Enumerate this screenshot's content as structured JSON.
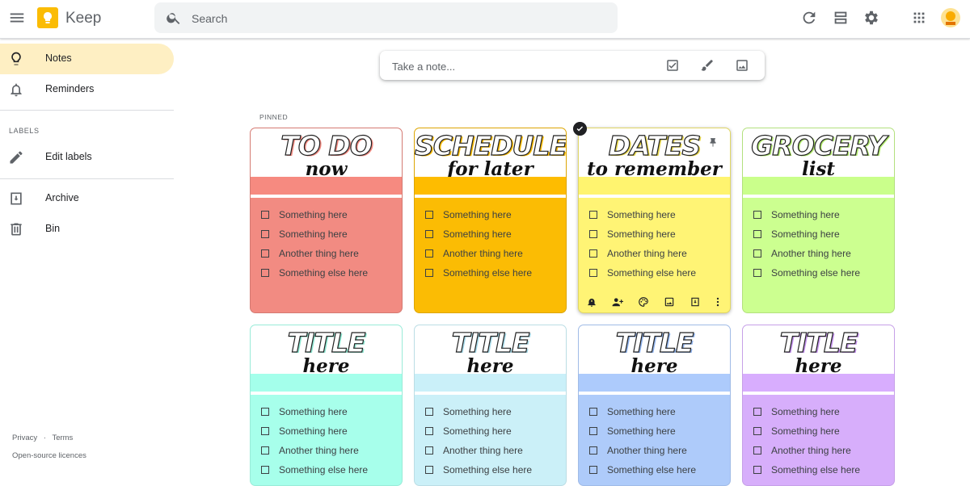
{
  "header": {
    "app_name": "Keep",
    "search_placeholder": "Search"
  },
  "sidebar": {
    "items": [
      {
        "label": "Notes",
        "icon": "lightbulb-icon",
        "active": true
      },
      {
        "label": "Reminders",
        "icon": "bell-icon"
      },
      {
        "label": "Edit labels",
        "icon": "pencil-icon"
      },
      {
        "label": "Archive",
        "icon": "archive-icon"
      },
      {
        "label": "Bin",
        "icon": "trash-icon"
      }
    ],
    "labels_heading": "LABELS",
    "footer": {
      "privacy": "Privacy",
      "separator": "·",
      "terms": "Terms",
      "licences": "Open-source licences"
    }
  },
  "take_note": {
    "placeholder": "Take a note..."
  },
  "pinned_label": "PINNED",
  "notes": [
    {
      "title1": "TO DO",
      "title2": "now",
      "color": "#f28b82",
      "shadow": "#f28b82",
      "items": [
        "Something here",
        "Something here",
        "Another thing here",
        "Something else here"
      ]
    },
    {
      "title1": "SCHEDULE",
      "title2": "for later",
      "color": "#fbbc04",
      "shadow": "#fbbc04",
      "items": [
        "Something here",
        "Something here",
        "Another thing here",
        "Something else here"
      ]
    },
    {
      "title1": "DATES",
      "title2": "to remember",
      "color": "#fff475",
      "shadow": "#e8d84a",
      "items": [
        "Something here",
        "Something here",
        "Another thing here",
        "Something else here"
      ]
    },
    {
      "title1": "GROCERY",
      "title2": "list",
      "color": "#ccff90",
      "shadow": "#b3ec70",
      "items": [
        "Something here",
        "Something here",
        "Another thing here",
        "Something else here"
      ]
    },
    {
      "title1": "TITLE",
      "title2": "here",
      "color": "#a7ffeb",
      "shadow": "#8ee8d3",
      "items": [
        "Something here",
        "Something here",
        "Another thing here",
        "Something else here"
      ]
    },
    {
      "title1": "TITLE",
      "title2": "here",
      "color": "#cbf0f8",
      "shadow": "#a8dceb",
      "items": [
        "Something here",
        "Something here",
        "Another thing here",
        "Something else here"
      ]
    },
    {
      "title1": "TITLE",
      "title2": "here",
      "color": "#aecbfa",
      "shadow": "#90b4ee",
      "items": [
        "Something here",
        "Something here",
        "Another thing here",
        "Something else here"
      ]
    },
    {
      "title1": "TITLE",
      "title2": "here",
      "color": "#d7aefb",
      "shadow": "#c593ef",
      "items": [
        "Something here",
        "Something here",
        "Another thing here",
        "Something else here"
      ]
    }
  ]
}
